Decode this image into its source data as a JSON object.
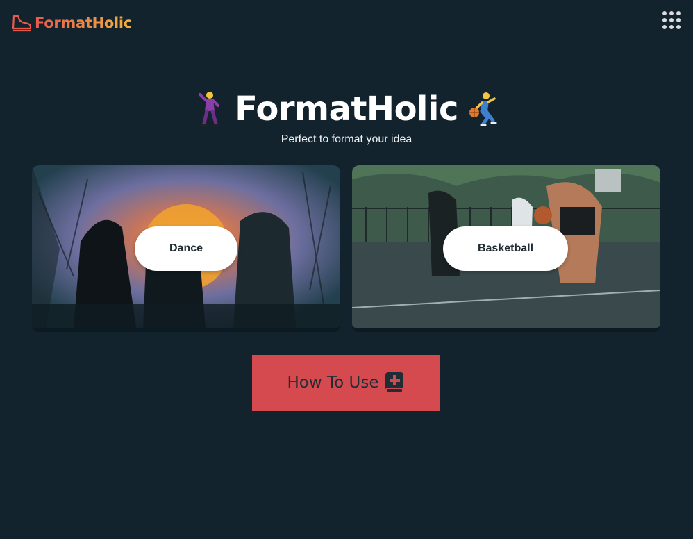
{
  "header": {
    "brand": "FormatHolic",
    "logo_icon": "sneaker-icon",
    "menu_icon": "grid-menu-icon"
  },
  "hero": {
    "title": "FormatHolic",
    "subtitle": "Perfect to format your idea",
    "left_emoji": "dancing-person-icon",
    "right_emoji": "basketball-player-icon"
  },
  "cards": [
    {
      "label": "Dance",
      "image": "dance-photo"
    },
    {
      "label": "Basketball",
      "image": "basketball-photo"
    }
  ],
  "how_to_use": {
    "label": "How To Use",
    "icon": "medical-book-icon"
  },
  "colors": {
    "background": "#13232d",
    "accent": "#d54a4f",
    "brand_gradient_start": "#e55b4d",
    "brand_gradient_end": "#f2b33d"
  }
}
